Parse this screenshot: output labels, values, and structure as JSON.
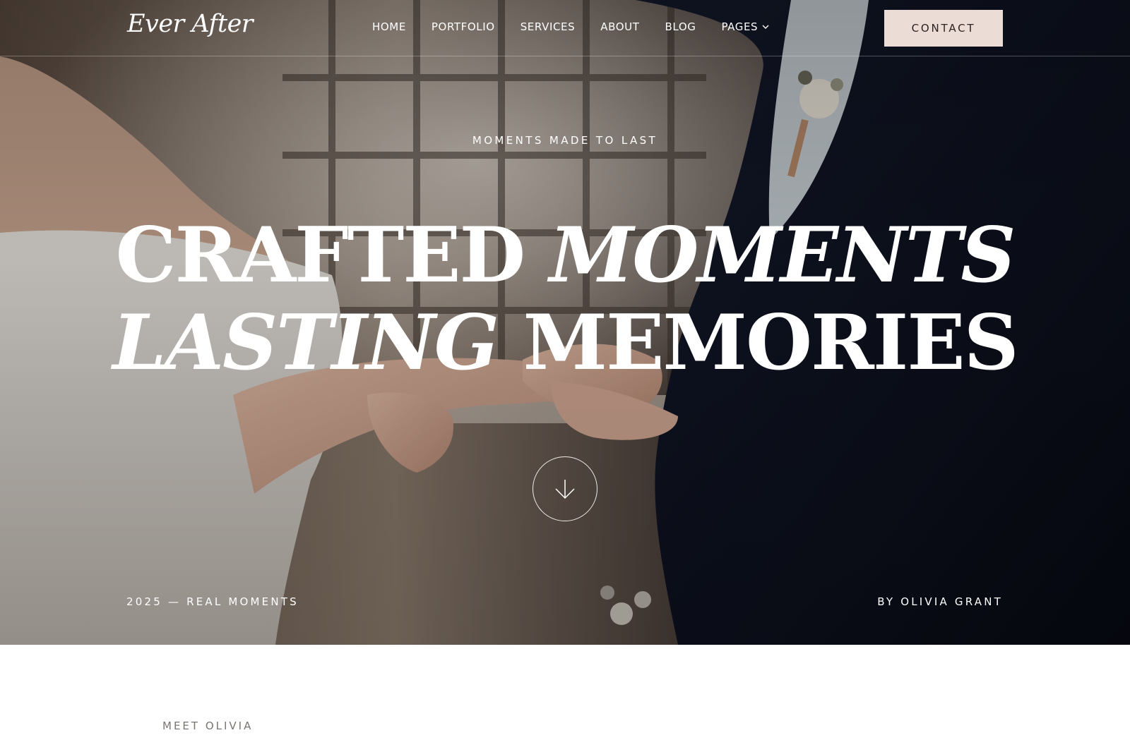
{
  "brand": {
    "logo": "Ever After"
  },
  "nav": {
    "items": [
      {
        "label": "HOME"
      },
      {
        "label": "PORTFOLIO"
      },
      {
        "label": "SERVICES"
      },
      {
        "label": "ABOUT"
      },
      {
        "label": "BLOG"
      },
      {
        "label": "PAGES",
        "icon": "chevron-down-icon"
      }
    ],
    "contact_label": "CONTACT"
  },
  "hero": {
    "eyebrow": "MOMENTS MADE TO LAST",
    "headline": {
      "line1_regular": "CRAFTED",
      "line1_italic": "MOMENTS",
      "line2_italic": "LASTING",
      "line2_regular": "MEMORIES"
    },
    "scroll_icon": "arrow-down-icon",
    "footer_left": "2025 — REAL MOMENTS",
    "footer_right": "BY OLIVIA GRANT"
  },
  "about": {
    "label": "MEET OLIVIA"
  },
  "colors": {
    "accent_button": "#ecdcd6",
    "button_text": "#2a2220",
    "hero_text": "#ffffff",
    "muted_text": "#7b7471"
  }
}
